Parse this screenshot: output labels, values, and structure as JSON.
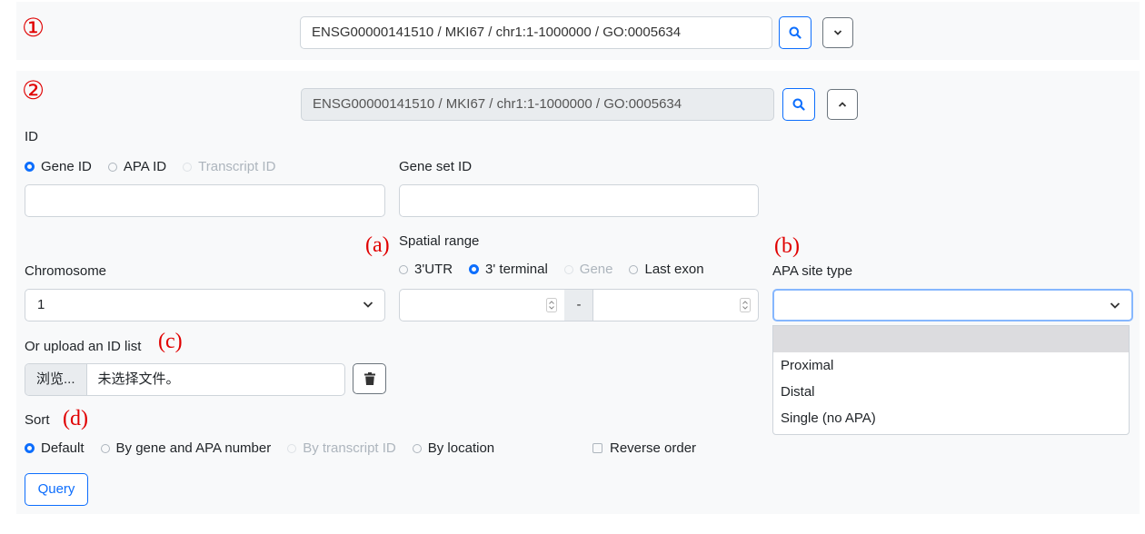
{
  "markers": {
    "m1": "①",
    "m2": "②"
  },
  "annotations": {
    "a": "(a)",
    "b": "(b)",
    "c": "(c)",
    "d": "(d)"
  },
  "collapsed": {
    "search_value": "ENSG00000141510 / MKI67 / chr1:1-1000000 / GO:0005634"
  },
  "expanded": {
    "search_value": "ENSG00000141510 / MKI67 / chr1:1-1000000 / GO:0005634"
  },
  "id_section": {
    "label": "ID",
    "options": [
      {
        "label": "Gene ID",
        "checked": true,
        "disabled": false
      },
      {
        "label": "APA ID",
        "checked": false,
        "disabled": false
      },
      {
        "label": "Transcript ID",
        "checked": false,
        "disabled": true
      }
    ],
    "id_input_value": ""
  },
  "gene_set": {
    "label": "Gene set ID",
    "value": ""
  },
  "spatial_range": {
    "label": "Spatial range",
    "options": [
      {
        "label": "3'UTR",
        "checked": false,
        "disabled": false
      },
      {
        "label": "3' terminal",
        "checked": true,
        "disabled": false
      },
      {
        "label": "Gene",
        "checked": false,
        "disabled": true
      },
      {
        "label": "Last exon",
        "checked": false,
        "disabled": false
      }
    ],
    "separator": "-",
    "from_value": "",
    "to_value": ""
  },
  "chromosome": {
    "label": "Chromosome",
    "selected": "1"
  },
  "apa_site_type": {
    "label": "APA site type",
    "selected": "",
    "options": [
      "",
      "Proximal",
      "Distal",
      "Single (no APA)"
    ]
  },
  "upload": {
    "label": "Or upload an ID list",
    "browse_label": "浏览...",
    "file_name": "未选择文件。"
  },
  "sort": {
    "label": "Sort",
    "options": [
      {
        "label": "Default",
        "checked": true,
        "disabled": false
      },
      {
        "label": "By gene and APA number",
        "checked": false,
        "disabled": false
      },
      {
        "label": "By transcript ID",
        "checked": false,
        "disabled": true
      },
      {
        "label": "By location",
        "checked": false,
        "disabled": false
      }
    ],
    "reverse_label": "Reverse order"
  },
  "query_label": "Query",
  "colors": {
    "accent": "#0d6efd",
    "annotation": "#e00000",
    "panel": "#f8f9fa"
  }
}
